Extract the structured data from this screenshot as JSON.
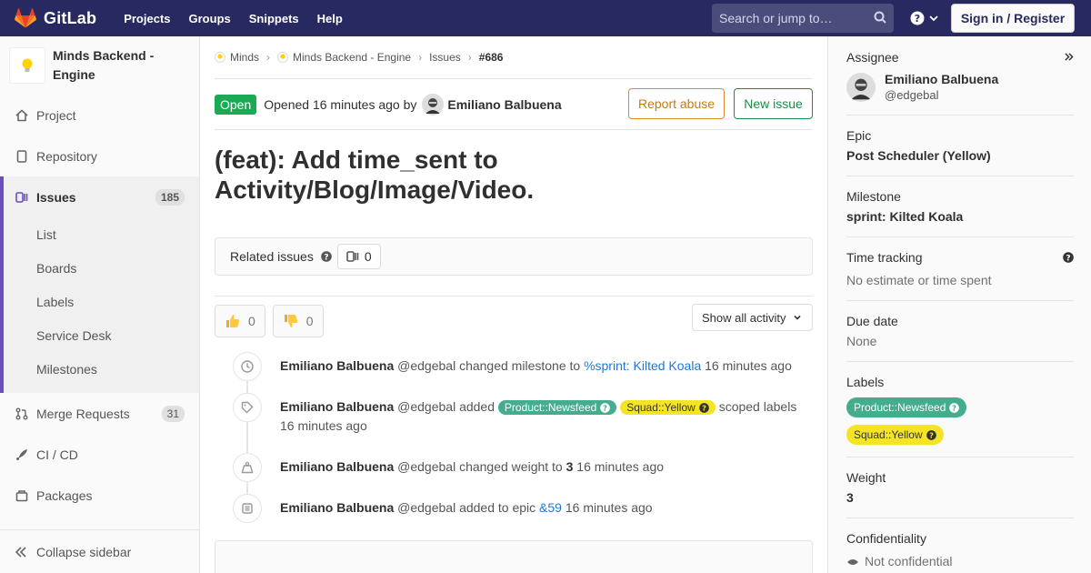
{
  "navbar": {
    "brand": "GitLab",
    "links": [
      "Projects",
      "Groups",
      "Snippets",
      "Help"
    ],
    "search_placeholder": "Search or jump to…",
    "signin": "Sign in / Register"
  },
  "sidebar": {
    "project_name": "Minds Backend - Engine",
    "items": [
      {
        "label": "Project",
        "icon": "home-icon"
      },
      {
        "label": "Repository",
        "icon": "doc-icon"
      },
      {
        "label": "Issues",
        "icon": "issues-icon",
        "count": "185"
      },
      {
        "label": "Merge Requests",
        "icon": "merge-request-icon",
        "count": "31"
      },
      {
        "label": "CI / CD",
        "icon": "rocket-icon"
      },
      {
        "label": "Packages",
        "icon": "package-icon"
      }
    ],
    "issue_sub": [
      "List",
      "Boards",
      "Labels",
      "Service Desk",
      "Milestones"
    ],
    "collapse": "Collapse sidebar"
  },
  "breadcrumb": [
    "Minds",
    "Minds Backend - Engine",
    "Issues",
    "#686"
  ],
  "issue": {
    "status": "Open",
    "opened": "Opened 16 minutes ago by",
    "author": "Emiliano Balbuena",
    "report_abuse": "Report abuse",
    "new_issue": "New issue",
    "title": "(feat): Add time_sent to Activity/Blog/Image/Video."
  },
  "related": {
    "label": "Related issues",
    "count": "0"
  },
  "awards": {
    "thumbsup": "0",
    "thumbsdown": "0",
    "activity_filter": "Show all activity"
  },
  "notes": [
    {
      "author": "Emiliano Balbuena",
      "handle": "@edgebal",
      "action": "changed milestone to",
      "link": "%sprint: Kilted Koala",
      "time": "16 minutes ago"
    },
    {
      "author": "Emiliano Balbuena",
      "handle": "@edgebal",
      "action": "added",
      "label1": "Product::Newsfeed",
      "label2": "Squad::Yellow",
      "suffix": "scoped labels",
      "time": "16 minutes ago"
    },
    {
      "author": "Emiliano Balbuena",
      "handle": "@edgebal",
      "action": "changed weight to",
      "value": "3",
      "time": "16 minutes ago"
    },
    {
      "author": "Emiliano Balbuena",
      "handle": "@edgebal",
      "action": "added to epic",
      "link": "&59",
      "time": "16 minutes ago"
    }
  ],
  "right": {
    "assignee_title": "Assignee",
    "assignee_name": "Emiliano Balbuena",
    "assignee_handle": "@edgebal",
    "epic_title": "Epic",
    "epic_value": "Post Scheduler (Yellow)",
    "milestone_title": "Milestone",
    "milestone_value": "sprint: Kilted Koala",
    "time_title": "Time tracking",
    "time_value": "No estimate or time spent",
    "due_title": "Due date",
    "due_value": "None",
    "labels_title": "Labels",
    "labels": [
      "Product::Newsfeed",
      "Squad::Yellow"
    ],
    "weight_title": "Weight",
    "weight_value": "3",
    "conf_title": "Confidentiality",
    "conf_value": "Not confidential"
  },
  "colors": {
    "navbar": "#292961",
    "open": "#1aaa55",
    "newsfeed": "#44ad8e",
    "yellow": "#f5e425",
    "link": "#1f78d1"
  }
}
